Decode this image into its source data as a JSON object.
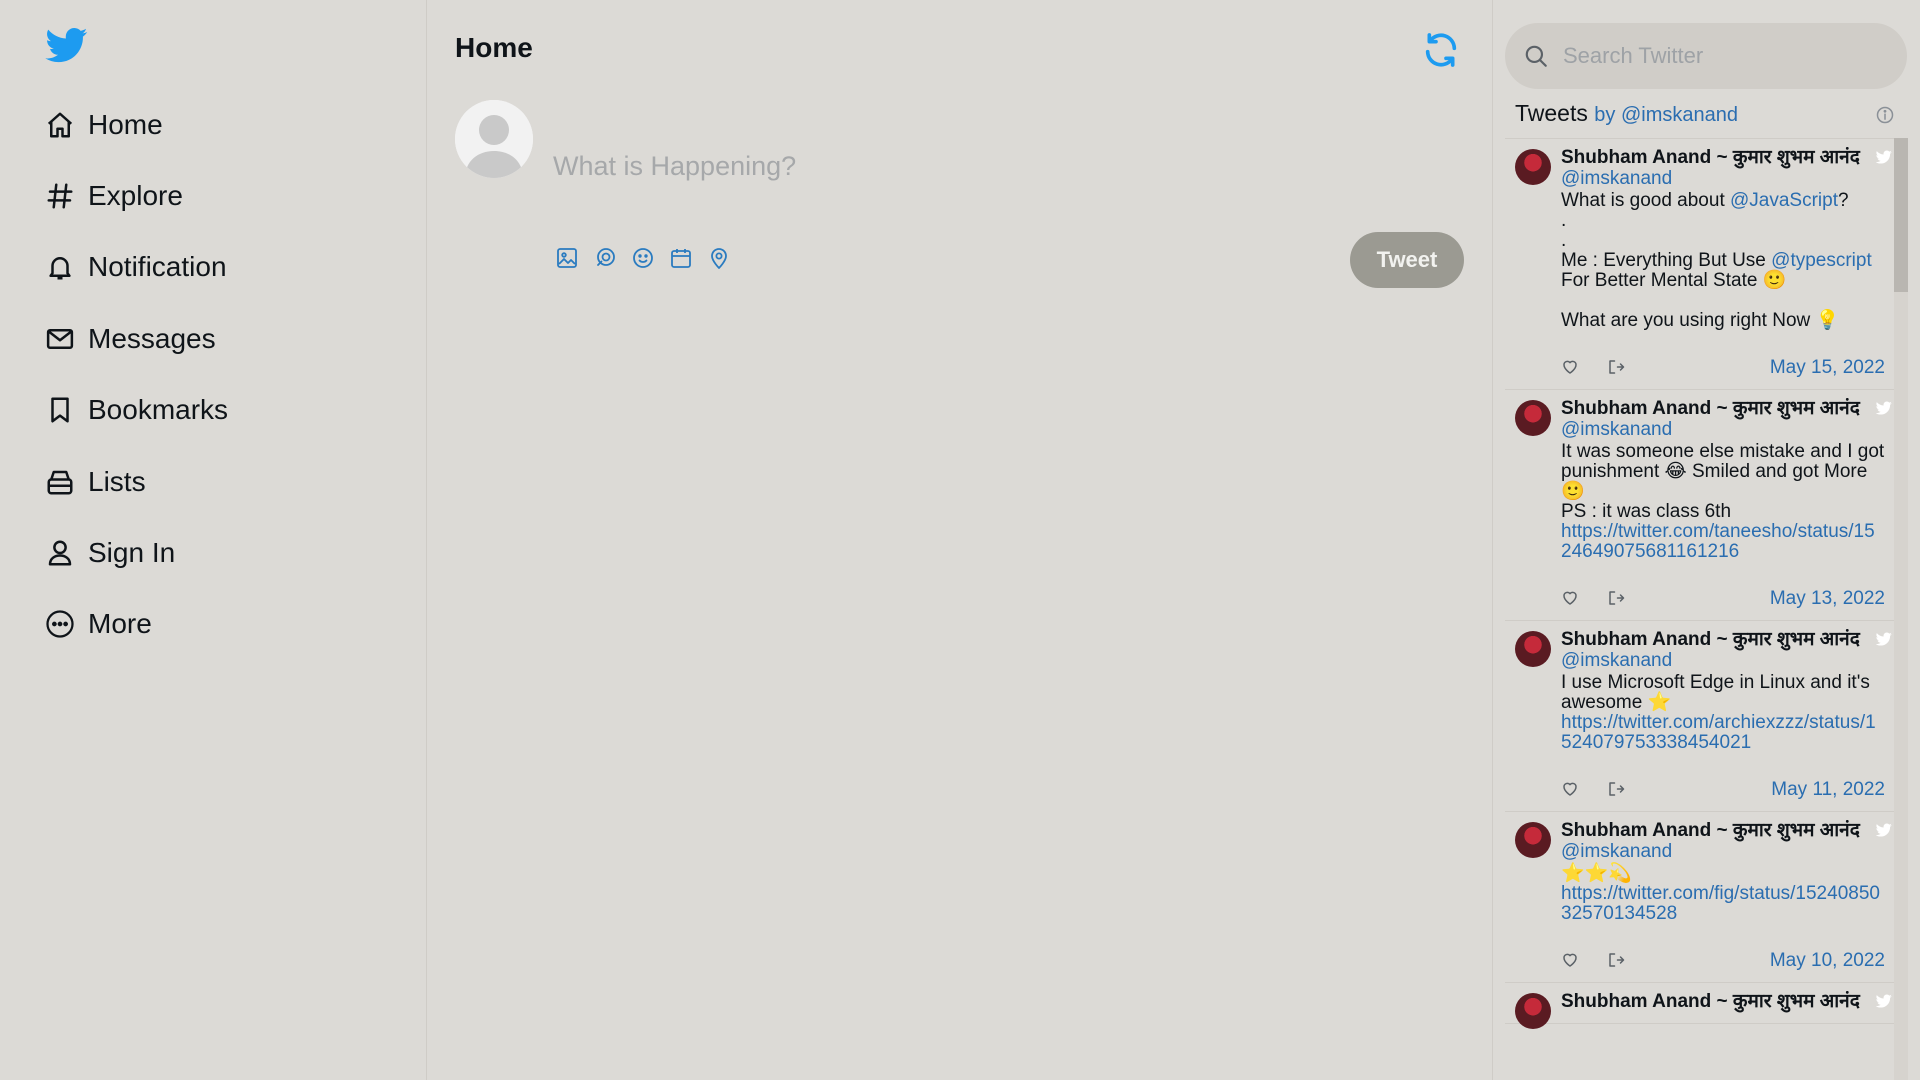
{
  "sidebar": {
    "items": [
      {
        "label": "Home",
        "icon": "home-icon"
      },
      {
        "label": "Explore",
        "icon": "hashtag-icon"
      },
      {
        "label": "Notification",
        "icon": "bell-icon"
      },
      {
        "label": "Messages",
        "icon": "mail-icon"
      },
      {
        "label": "Bookmarks",
        "icon": "bookmark-icon"
      },
      {
        "label": "Lists",
        "icon": "lists-icon"
      },
      {
        "label": "Sign In",
        "icon": "user-icon"
      },
      {
        "label": "More",
        "icon": "more-icon"
      }
    ]
  },
  "main": {
    "title": "Home",
    "compose": {
      "placeholder": "What is Happening?",
      "tools": [
        "image-icon",
        "gif-icon",
        "emoji-icon",
        "schedule-icon",
        "location-icon"
      ],
      "tweet_label": "Tweet"
    }
  },
  "right": {
    "search_placeholder": "Search Twitter",
    "widget_title": "Tweets",
    "widget_by": "by @imskanand",
    "tweets": [
      {
        "name": "Shubham Anand ~ कुमार शुभम आनंद",
        "handle": "@imskanand",
        "body": [
          {
            "t": "What is good about "
          },
          {
            "l": "@JavaScript"
          },
          {
            "t": "?\n.\n.\nMe : Everything But Use "
          },
          {
            "l": "@typescript"
          },
          {
            "t": " For Better Mental State 🙂\n\nWhat are you using right Now 💡"
          }
        ],
        "date": "May 15, 2022"
      },
      {
        "name": "Shubham Anand ~ कुमार शुभम आनंद",
        "handle": "@imskanand",
        "body": [
          {
            "t": "It was someone else mistake and I got punishment 😂 Smiled and got More 🙂\nPS : it was class 6th\n"
          },
          {
            "l": "https://twitter.com/taneesho/status/1524649075681161216"
          }
        ],
        "date": "May 13, 2022"
      },
      {
        "name": "Shubham Anand ~ कुमार शुभम आनंद",
        "handle": "@imskanand",
        "body": [
          {
            "t": "I use Microsoft Edge in Linux and it's awesome ⭐\n"
          },
          {
            "l": "https://twitter.com/archiexzzz/status/1524079753338454021"
          }
        ],
        "date": "May 11, 2022"
      },
      {
        "name": "Shubham Anand ~ कुमार शुभम आनंद",
        "handle": "@imskanand",
        "body": [
          {
            "t": "⭐⭐💫\n"
          },
          {
            "l": "https://twitter.com/fig/status/1524085032570134528"
          }
        ],
        "date": "May 10, 2022"
      },
      {
        "name": "Shubham Anand ~ कुमार शुभम आनंद",
        "handle": "",
        "body": [],
        "date": ""
      }
    ]
  },
  "colors": {
    "background": "#dcdad6",
    "twitter_blue": "#1d9bf0",
    "link": "#2a6db0",
    "tweet_button": "#9b9a92"
  }
}
